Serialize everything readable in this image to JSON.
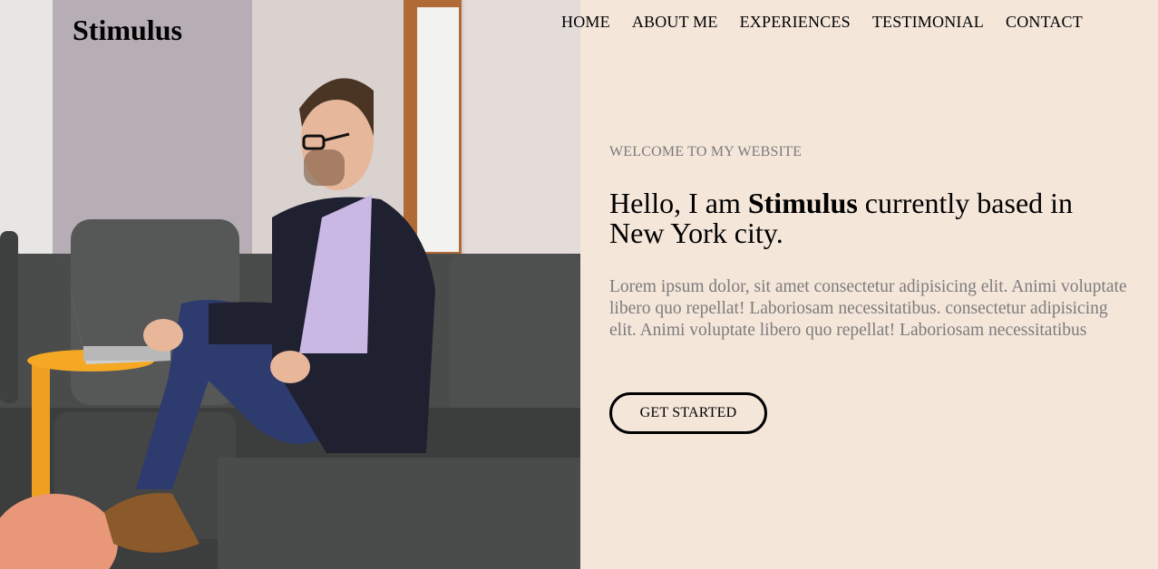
{
  "brand": {
    "logo": "Stimulus"
  },
  "nav": [
    {
      "label": "HOME"
    },
    {
      "label": "ABOUT ME"
    },
    {
      "label": "EXPERIENCES"
    },
    {
      "label": "TESTIMONIAL"
    },
    {
      "label": "CONTACT"
    }
  ],
  "hero": {
    "eyebrow": "WELCOME TO MY WEBSITE",
    "headline_pre": "Hello, I am ",
    "headline_name": "Stimulus",
    "headline_post": " currently based in New York city.",
    "intro": "Lorem ipsum dolor, sit amet consectetur adipisicing elit. Animi voluptate libero quo repellat! Laboriosam necessitatibus. consectetur adipisicing elit. Animi voluptate libero quo repellat! Laboriosam necessitatibus",
    "cta_label": "GET STARTED"
  },
  "colors": {
    "panel_bg": "#f5e6da",
    "text": "#000000",
    "muted": "#7c7c7c"
  }
}
